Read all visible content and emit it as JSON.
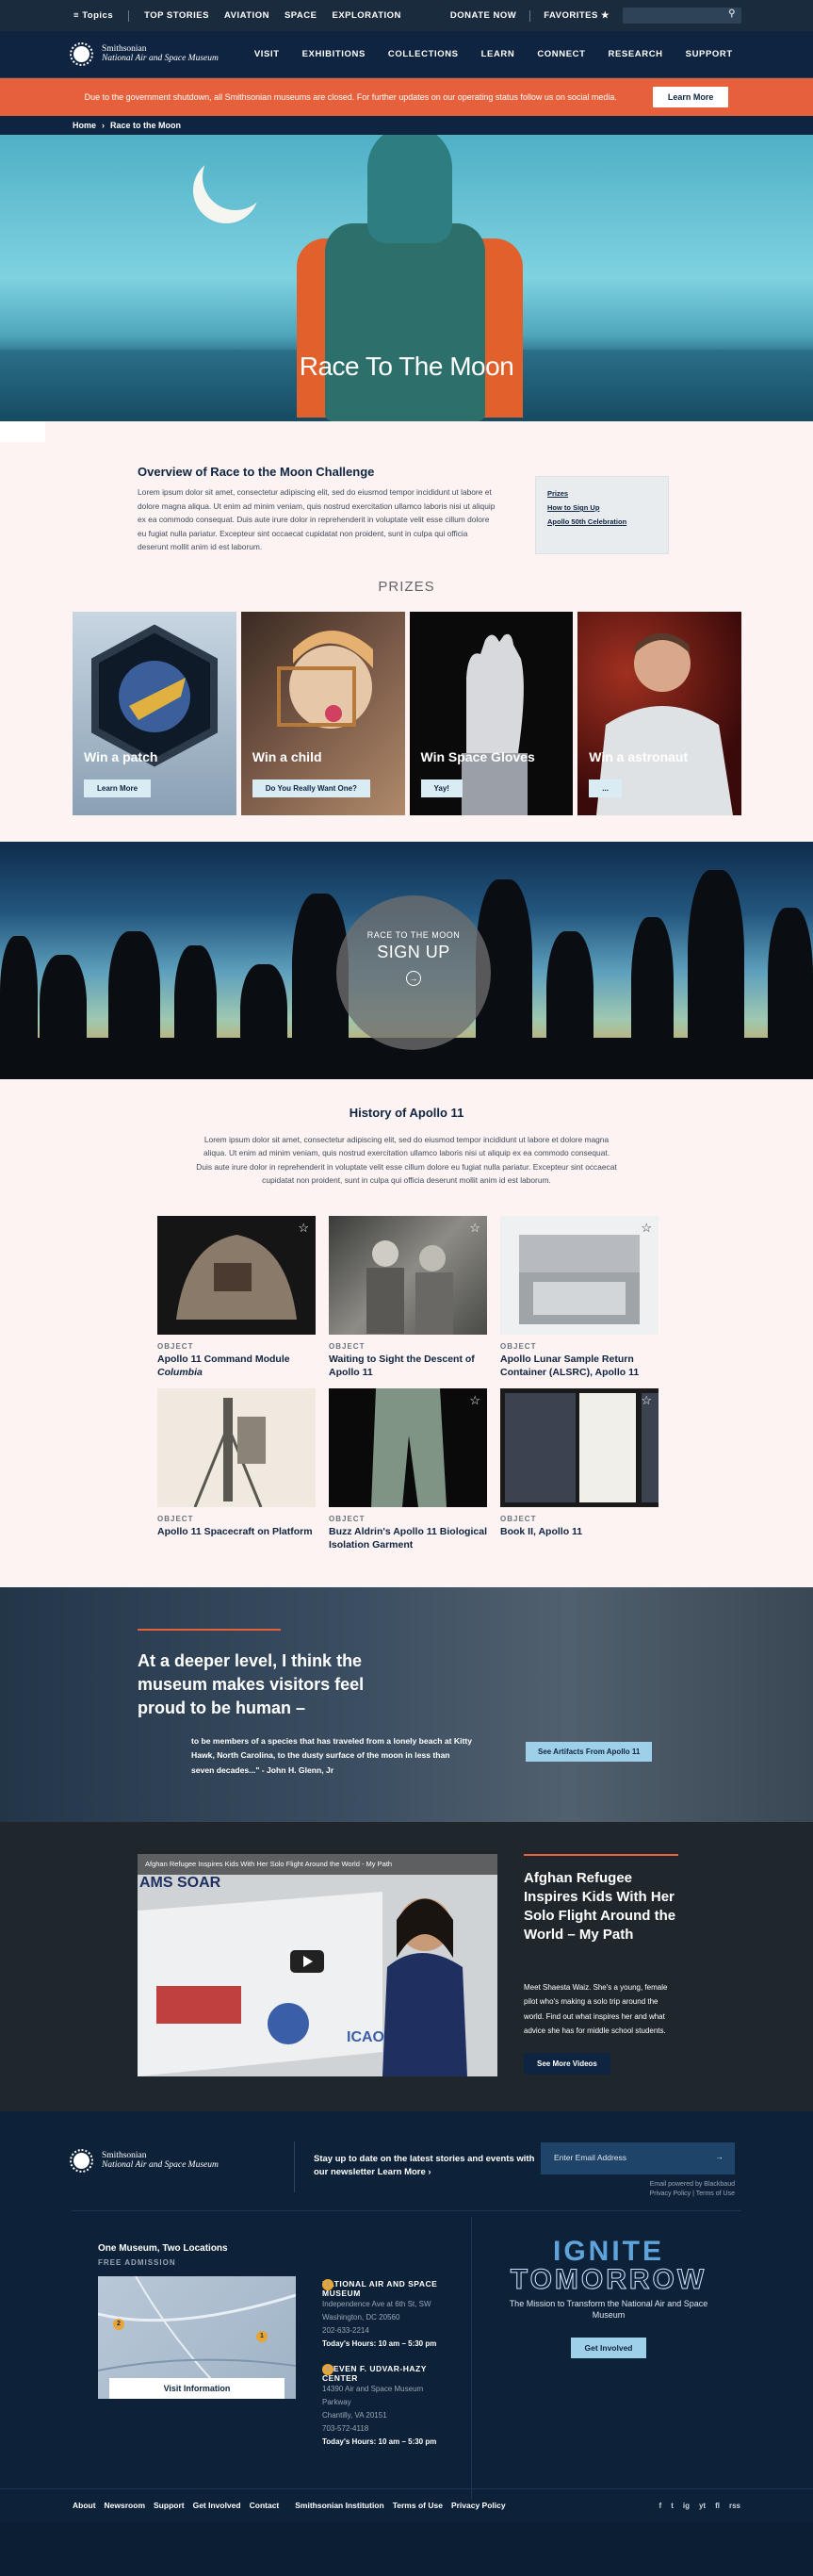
{
  "topbar": {
    "topics": "Topics",
    "links": [
      "TOP STORIES",
      "AVIATION",
      "SPACE",
      "EXPLORATION"
    ],
    "donate": "DONATE NOW",
    "favorites": "FAVORITES"
  },
  "brand": {
    "line1": "Smithsonian",
    "line2": "National Air and Space Museum"
  },
  "nav": [
    "VISIT",
    "EXHIBITIONS",
    "COLLECTIONS",
    "LEARN",
    "CONNECT",
    "RESEARCH",
    "SUPPORT"
  ],
  "alert": {
    "text": "Due to the government shutdown, all Smithsonian museums are closed. For further updates on our operating status follow us on social media.",
    "button": "Learn More"
  },
  "breadcrumb": {
    "home": "Home",
    "current": "Race to the Moon"
  },
  "hero": {
    "title": "Race To The Moon"
  },
  "overview": {
    "title": "Overview of Race to the Moon Challenge",
    "body": "Lorem ipsum dolor sit amet, consectetur adipiscing elit, sed do eiusmod tempor incididunt ut labore et dolore magna aliqua. Ut enim ad minim veniam, quis nostrud exercitation ullamco laboris nisi ut aliquip ex ea commodo consequat. Duis aute irure dolor in reprehenderit in voluptate velit esse cillum dolore eu fugiat nulla pariatur. Excepteur sint occaecat cupidatat non proident, sunt in culpa qui officia deserunt mollit anim id est laborum.",
    "links": [
      "Prizes",
      "How to Sign Up",
      "Apollo 50th Celebration"
    ]
  },
  "prizes": {
    "heading": "PRIZES",
    "items": [
      {
        "caption": "Win a patch",
        "button": "Learn More"
      },
      {
        "caption": "Win a child",
        "button": "Do You Really Want One?"
      },
      {
        "caption": "Win Space Gloves",
        "button": "Yay!"
      },
      {
        "caption": "Win a astronaut",
        "button": "..."
      }
    ]
  },
  "signup": {
    "small": "RACE TO THE MOON",
    "big": "SIGN UP"
  },
  "history": {
    "title": "History of Apollo 11",
    "body": "Lorem ipsum dolor sit amet, consectetur adipiscing elit, sed do eiusmod tempor incididunt ut labore et dolore magna aliqua. Ut enim ad minim veniam, quis nostrud exercitation ullamco laboris nisi ut aliquip ex ea commodo consequat. Duis aute irure dolor in reprehenderit in voluptate velit esse cillum dolore eu fugiat nulla pariatur. Excepteur sint occaecat cupidatat non proident, sunt in culpa qui officia deserunt mollit anim id est laborum.",
    "label": "OBJECT",
    "objects": [
      {
        "title": "Apollo 11 Command Module",
        "title2": "Columbia"
      },
      {
        "title": "Waiting to Sight the Descent of Apollo 11"
      },
      {
        "title": "Apollo Lunar Sample Return Container (ALSRC), Apollo 11"
      },
      {
        "title": "Apollo 11 Spacecraft on Platform"
      },
      {
        "title": "Buzz Aldrin's Apollo 11 Biological Isolation Garment"
      },
      {
        "title": "Book II, Apollo 11"
      }
    ]
  },
  "quote": {
    "headline": "At a deeper level, I think the museum makes visitors feel proud to be human –",
    "body": "to be members of a species that has traveled from a lonely beach at Kitty Hawk, North Carolina, to the dusty surface of the moon in less than seven decades...\" - John H. Glenn, Jr",
    "button": "See Artifacts From Apollo 11"
  },
  "video": {
    "player_title": "Afghan Refugee Inspires Kids With Her Solo Flight Around the World - My Path",
    "title": "Afghan Refugee Inspires Kids With Her Solo Flight Around the World – My Path",
    "body": "Meet Shaesta Waiz. She's a young, female pilot who's making a solo trip around the world. Find out what inspires her and what advice she has for middle school students.",
    "button": "See More Videos",
    "plane_text": "AMS SOAR",
    "icao": "ICAO"
  },
  "footer": {
    "newsletter": "Stay up to date on the latest stories and events with our newsletter",
    "learn_more": "Learn More ›",
    "email_placeholder": "Enter Email Address",
    "powered": "Email powered by Blackbaud",
    "privacy": "Privacy Policy | Terms of Use",
    "locations_title": "One Museum, Two Locations",
    "admission": "FREE ADMISSION",
    "visit_button": "Visit Information",
    "museums": [
      {
        "num": "1",
        "name": "NATIONAL AIR AND SPACE MUSEUM",
        "address": "Independence Ave at 6th St, SW",
        "city": "Washington, DC 20560",
        "phone": "202-633-2214",
        "hours": "Today's Hours: 10 am – 5:30 pm"
      },
      {
        "num": "2",
        "name": "STEVEN F. UDVAR-HAZY CENTER",
        "address": "14390 Air and Space Museum Parkway",
        "city": "Chantilly, VA 20151",
        "phone": "703-572-4118",
        "hours": "Today's Hours: 10 am – 5:30 pm"
      }
    ],
    "ignite": {
      "line1": "IGNITE",
      "line2": "TOMORROW",
      "sub": "The Mission to Transform the National Air and Space Museum",
      "button": "Get Involved"
    },
    "links": [
      "About",
      "Newsroom",
      "Support",
      "Get Involved",
      "Contact",
      "Smithsonian Institution",
      "Terms of Use",
      "Privacy Policy"
    ],
    "social": [
      "f",
      "t",
      "ig",
      "yt",
      "fl",
      "rss"
    ]
  }
}
